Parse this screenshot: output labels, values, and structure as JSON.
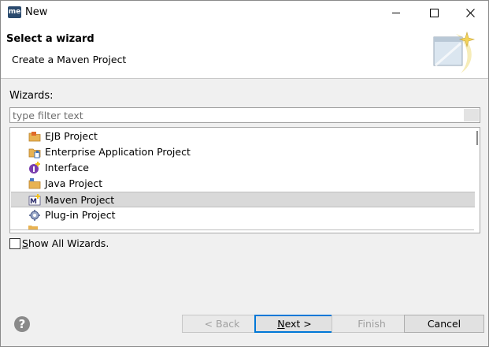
{
  "window": {
    "title": "New",
    "app_icon_text": "me"
  },
  "banner": {
    "title": "Select a wizard",
    "description": "Create a Maven Project"
  },
  "wizards_label": "Wizards:",
  "filter": {
    "placeholder": "type filter text",
    "value": ""
  },
  "list": {
    "items": [
      {
        "label": "EJB Project",
        "icon": "ejb-project-icon"
      },
      {
        "label": "Enterprise Application Project",
        "icon": "ear-project-icon"
      },
      {
        "label": "Interface",
        "icon": "interface-icon"
      },
      {
        "label": "Java Project",
        "icon": "java-project-icon"
      },
      {
        "label": "Maven Project",
        "icon": "maven-project-icon",
        "selected": true
      },
      {
        "label": "Plug-in Project",
        "icon": "plugin-project-icon"
      }
    ]
  },
  "show_all": {
    "prefix": "S",
    "label_rest": "how All Wizards.",
    "checked": false
  },
  "buttons": {
    "back": "< Back",
    "next_prefix": "N",
    "next_rest": "ext >",
    "finish": "Finish",
    "cancel": "Cancel"
  },
  "colors": {
    "accent": "#0078d7",
    "selection": "#d9d9d9"
  }
}
